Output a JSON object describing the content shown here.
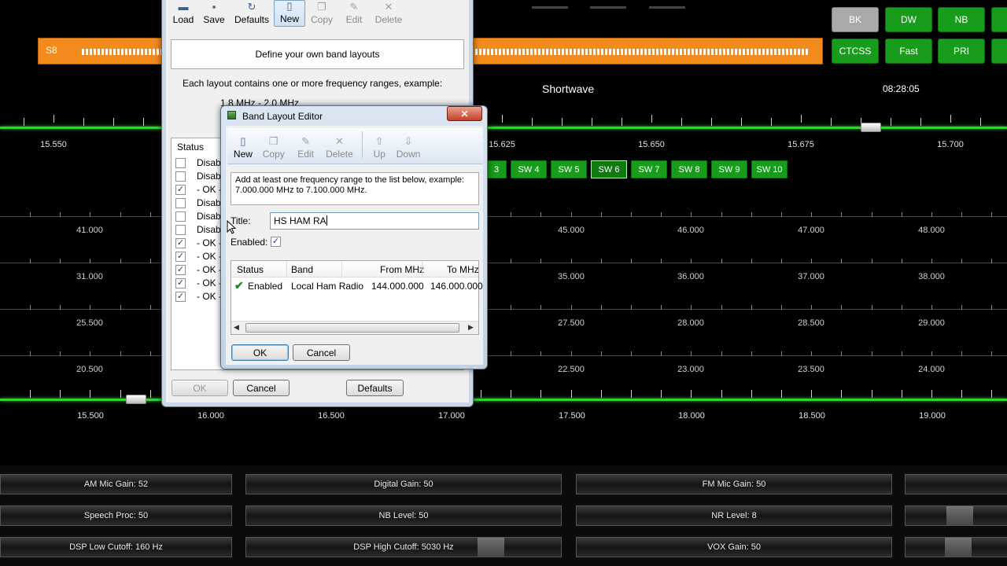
{
  "radio": {
    "smeter_label": "S8",
    "top_buttons": [
      {
        "label": "BK",
        "style": "gray"
      },
      {
        "label": "DW",
        "style": "green"
      },
      {
        "label": "NB",
        "style": "green"
      },
      {
        "label": "CTCSS",
        "style": "green"
      },
      {
        "label": "Fast",
        "style": "green"
      },
      {
        "label": "PRI",
        "style": "green"
      }
    ],
    "band_title": "Shortwave",
    "clock": "08:28:05",
    "upper_scale_labels": [
      "15.550",
      "15.625",
      "15.650",
      "15.675",
      "15.700"
    ],
    "sw_buttons": [
      "3",
      "SW 4",
      "SW 5",
      "SW 6",
      "SW 7",
      "SW 8",
      "SW 9",
      "SW 10"
    ],
    "grid_rows": [
      {
        "left": "41.000",
        "labels": [
          "45.000",
          "46.000",
          "47.000",
          "48.000"
        ]
      },
      {
        "left": "31.000",
        "labels": [
          "35.000",
          "36.000",
          "37.000",
          "38.000"
        ]
      },
      {
        "left": "25.500",
        "labels": [
          "27.500",
          "28.000",
          "28.500",
          "29.000"
        ]
      },
      {
        "left": "20.500",
        "labels": [
          "22.500",
          "23.000",
          "23.500",
          "24.000"
        ]
      }
    ],
    "lower_scale_labels": [
      "15.500",
      "16.000",
      "16.500",
      "17.000",
      "17.500",
      "18.000",
      "18.500",
      "19.000"
    ],
    "gain_controls": [
      [
        "AM Mic Gain: 52",
        "Digital Gain: 50",
        "FM Mic Gain: 50"
      ],
      [
        "Speech Proc: 50",
        "NB Level: 50",
        "NR Level: 8"
      ],
      [
        "DSP Low Cutoff: 160 Hz",
        "DSP High Cutoff: 5030 Hz",
        "VOX Gain: 50"
      ]
    ]
  },
  "bands_window": {
    "toolbar": [
      {
        "label": "Load",
        "icon": "folder-icon",
        "state": "normal"
      },
      {
        "label": "Save",
        "icon": "save-icon",
        "state": "normal"
      },
      {
        "label": "Defaults",
        "icon": "refresh-icon",
        "state": "normal"
      },
      {
        "label": "New",
        "icon": "new-doc-icon",
        "state": "pressed"
      },
      {
        "label": "Copy",
        "icon": "copy-icon",
        "state": "disabled"
      },
      {
        "label": "Edit",
        "icon": "edit-icon",
        "state": "disabled"
      },
      {
        "label": "Delete",
        "icon": "delete-icon",
        "state": "disabled"
      }
    ],
    "heading": "Define your own band layouts",
    "info_line": "Each layout contains one or more frequency ranges, example:",
    "example_line": "1.8 MHz - 2.0 MHz",
    "status_header": "Status",
    "rows": [
      {
        "checked": false,
        "status": "Disab"
      },
      {
        "checked": false,
        "status": "Disab"
      },
      {
        "checked": true,
        "status": "- OK -"
      },
      {
        "checked": false,
        "status": "Disab"
      },
      {
        "checked": false,
        "status": "Disab"
      },
      {
        "checked": false,
        "status": "Disab"
      },
      {
        "checked": true,
        "status": "- OK -"
      },
      {
        "checked": true,
        "status": "- OK -"
      },
      {
        "checked": true,
        "status": "- OK -"
      },
      {
        "checked": true,
        "status": "- OK -"
      },
      {
        "checked": true,
        "status": "- OK -"
      }
    ],
    "ok_label": "OK",
    "cancel_label": "Cancel",
    "defaults_label": "Defaults"
  },
  "editor": {
    "title": "Band Layout Editor",
    "close_glyph": "✕",
    "toolbar": [
      {
        "label": "New",
        "icon": "new-doc-icon",
        "state": "normal"
      },
      {
        "label": "Copy",
        "icon": "copy-icon",
        "state": "disabled"
      },
      {
        "label": "Edit",
        "icon": "edit-icon",
        "state": "disabled"
      },
      {
        "label": "Delete",
        "icon": "delete-icon",
        "state": "disabled"
      },
      {
        "label": "Up",
        "icon": "arrow-up-icon",
        "state": "disabled"
      },
      {
        "label": "Down",
        "icon": "arrow-down-icon",
        "state": "disabled"
      }
    ],
    "hint_line1": "Add at least one frequency range to the list below, example:",
    "hint_line2": "7.000.000 MHz to 7.100.000 MHz.",
    "title_label": "Title:",
    "title_value": "HS HAM RA",
    "enabled_label": "Enabled:",
    "enabled_checked": true,
    "columns": [
      "Status",
      "Band",
      "From MHz",
      "To MHz"
    ],
    "rows": [
      {
        "status": "Enabled",
        "band": "Local Ham Radio",
        "from": "144.000.000",
        "to": "146.000.000"
      }
    ],
    "ok_label": "OK",
    "cancel_label": "Cancel"
  }
}
